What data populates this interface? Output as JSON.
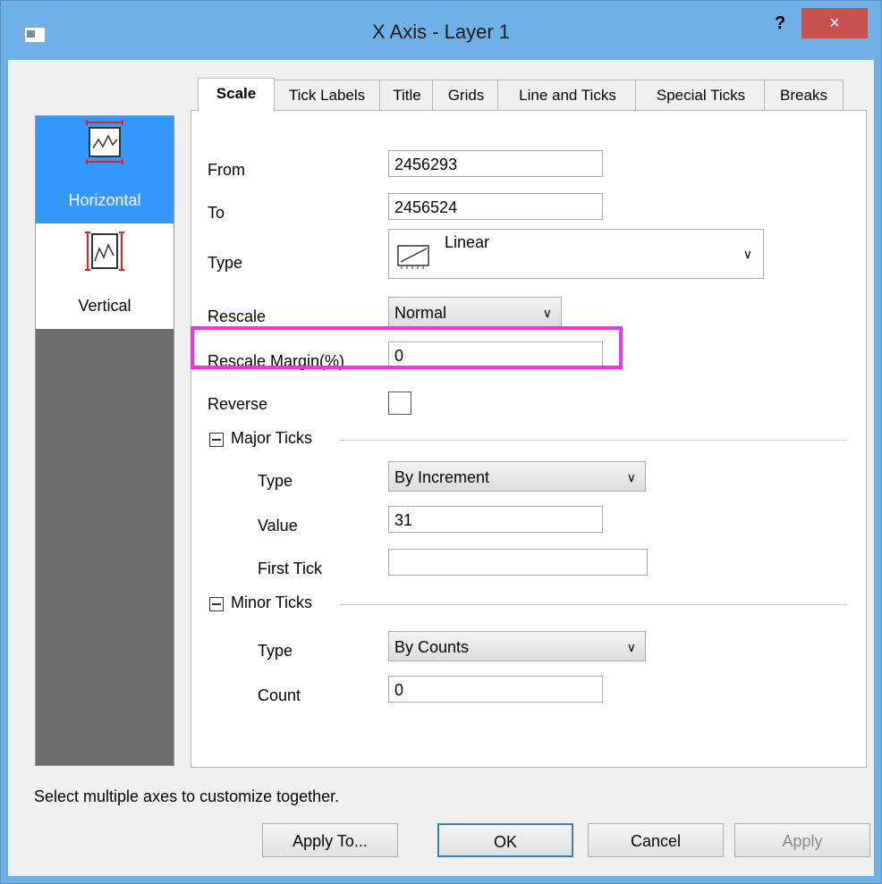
{
  "window": {
    "title": "X Axis - Layer 1",
    "help_label": "?",
    "close_label": "×"
  },
  "sidebar": {
    "items": [
      {
        "label": "Horizontal",
        "selected": true
      },
      {
        "label": "Vertical",
        "selected": false
      }
    ]
  },
  "tabs": [
    {
      "label": "Scale",
      "active": true
    },
    {
      "label": "Tick Labels"
    },
    {
      "label": "Title"
    },
    {
      "label": "Grids"
    },
    {
      "label": "Line and Ticks"
    },
    {
      "label": "Special Ticks"
    },
    {
      "label": "Breaks"
    }
  ],
  "scale": {
    "from_label": "From",
    "from_value": "2456293",
    "to_label": "To",
    "to_value": "2456524",
    "type_label": "Type",
    "type_value": "Linear",
    "rescale_label": "Rescale",
    "rescale_value": "Normal",
    "rescale_margin_label": "Rescale Margin(%)",
    "rescale_margin_value": "0",
    "reverse_label": "Reverse",
    "reverse_checked": false
  },
  "major_ticks": {
    "group_label": "Major Ticks",
    "type_label": "Type",
    "type_value": "By Increment",
    "value_label": "Value",
    "value_value": "31",
    "first_tick_label": "First Tick",
    "first_tick_value": ""
  },
  "minor_ticks": {
    "group_label": "Minor Ticks",
    "type_label": "Type",
    "type_value": "By Counts",
    "count_label": "Count",
    "count_value": "0"
  },
  "status_text": "Select multiple axes to customize together.",
  "buttons": {
    "apply_to": "Apply To...",
    "ok": "OK",
    "cancel": "Cancel",
    "apply": "Apply"
  },
  "colors": {
    "title_bar": "#6fb0e6",
    "close_button": "#c75050",
    "selection": "#3399ff",
    "highlight": "#ee33ee"
  }
}
